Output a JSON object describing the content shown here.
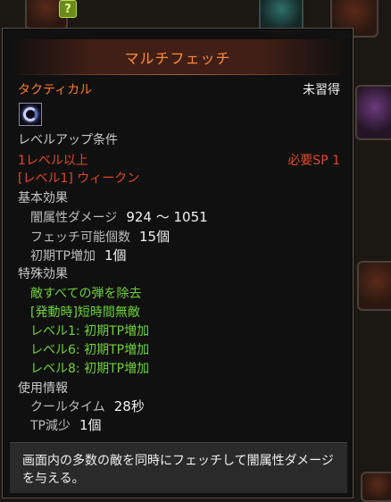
{
  "tooltip": {
    "title": "マルチフェッチ",
    "category": "タクティカル",
    "learn_status": "未習得",
    "levelup_header": "レベルアップ条件",
    "req_level": "1レベル以上",
    "req_sp": "必要SP 1",
    "req_skill": "[レベル1] ウィークン",
    "basic_header": "基本効果",
    "basic": [
      {
        "label": "闇属性ダメージ",
        "value": "924 ～ 1051"
      },
      {
        "label": "フェッチ可能個数",
        "value": "15個"
      },
      {
        "label": "初期TP増加",
        "value": "1個"
      }
    ],
    "special_header": "特殊効果",
    "special": [
      "敵すべての弾を除去",
      "[発動時]短時間無敵",
      "レベル1: 初期TP増加",
      "レベル6: 初期TP増加",
      "レベル8: 初期TP増加"
    ],
    "usage_header": "使用情報",
    "usage": [
      {
        "label": "クールタイム",
        "value": "28秒"
      },
      {
        "label": "TP減少",
        "value": "1個"
      }
    ],
    "description": "画面内の多数の敵を同時にフェッチして闇属性ダメージを与える。"
  },
  "background": {
    "badge": "?"
  }
}
